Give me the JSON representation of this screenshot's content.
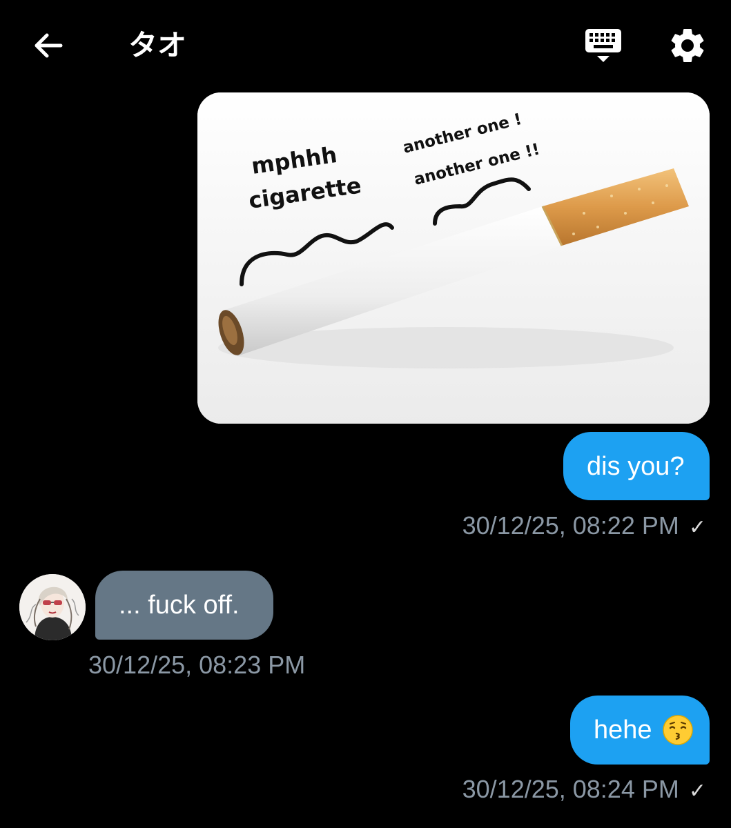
{
  "header": {
    "title": "タオ",
    "back_icon": "arrow-left-icon",
    "keyboard_icon": "keyboard-icon",
    "settings_icon": "gear-icon"
  },
  "messages": [
    {
      "type": "image",
      "direction": "outgoing",
      "image_text": {
        "caption_left_line1": "mphhh",
        "caption_left_line2": "cigarette",
        "caption_right_line1": "another one !",
        "caption_right_line2": "another one !!"
      }
    },
    {
      "type": "text",
      "direction": "outgoing",
      "text": "dis you?",
      "timestamp": "30/12/25, 08:22 PM",
      "status": "✓"
    },
    {
      "type": "text",
      "direction": "incoming",
      "text": "... fuck off.",
      "timestamp": "30/12/25, 08:23 PM"
    },
    {
      "type": "text",
      "direction": "outgoing",
      "text": "hehe",
      "emoji": "kissing-face-icon",
      "timestamp": "30/12/25, 08:24 PM",
      "status": "✓"
    }
  ],
  "colors": {
    "outgoing_bubble": "#1da1f2",
    "incoming_bubble": "#657786",
    "timestamp": "#8b98a5",
    "background": "#000000"
  }
}
